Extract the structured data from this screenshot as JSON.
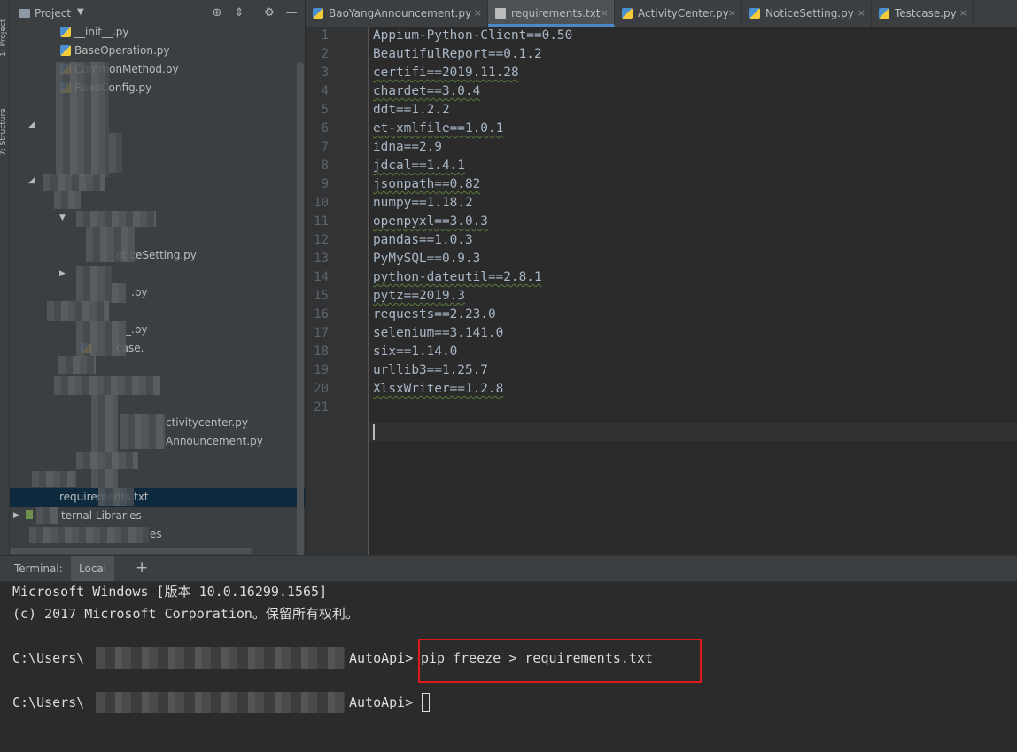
{
  "tool_strip": {
    "tabs": [
      "1: Project",
      "7: Structure"
    ]
  },
  "project_panel": {
    "title": "Project",
    "tree": [
      "__init__.py",
      "BaseOperation.py",
      "CommonMethod.py",
      "ReadConfig.py",
      "oticeSetting.py",
      "_.py",
      "_.py",
      "case.",
      "ctivitycenter.py",
      "Announcement.py",
      "requirements.txt",
      "ternal Libraries",
      "es"
    ]
  },
  "editor": {
    "tabs": [
      {
        "label": "BaoYangAnnouncement.py",
        "active": false
      },
      {
        "label": "requirements.txt",
        "active": true
      },
      {
        "label": "ActivityCenter.py",
        "active": false
      },
      {
        "label": "NoticeSetting.py",
        "active": false
      },
      {
        "label": "Testcase.py",
        "active": false
      }
    ],
    "lines": [
      "Appium-Python-Client==0.50",
      "BeautifulReport==0.1.2",
      "certifi==2019.11.28",
      "chardet==3.0.4",
      "ddt==1.2.2",
      "et-xmlfile==1.0.1",
      "idna==2.9",
      "jdcal==1.4.1",
      "jsonpath==0.82",
      "numpy==1.18.2",
      "openpyxl==3.0.3",
      "pandas==1.0.3",
      "PyMySQL==0.9.3",
      "python-dateutil==2.8.1",
      "pytz==2019.3",
      "requests==2.23.0",
      "selenium==3.141.0",
      "six==1.14.0",
      "urllib3==1.25.7",
      "XlsxWriter==1.2.8",
      ""
    ],
    "line_numbers": [
      "1",
      "2",
      "3",
      "4",
      "5",
      "6",
      "7",
      "8",
      "9",
      "10",
      "11",
      "12",
      "13",
      "14",
      "15",
      "16",
      "17",
      "18",
      "19",
      "20",
      "21"
    ]
  },
  "terminal": {
    "label": "Terminal:",
    "tab": "Local",
    "add": "+",
    "lines": {
      "l1": "Microsoft Windows [版本 10.0.16299.1565]",
      "l2": "(c) 2017 Microsoft Corporation。保留所有权利。",
      "prompt1_prefix": "C:\\Users\\",
      "prompt1_suffix": "AutoApi>",
      "command": "pip freeze > requirements.txt",
      "prompt2_prefix": "C:\\Users\\",
      "prompt2_suffix": "AutoApi>"
    }
  },
  "colors": {
    "highlight_box": "#e0191d",
    "active_tab_underline": "#4a88c7",
    "selection": "#0d293e"
  }
}
